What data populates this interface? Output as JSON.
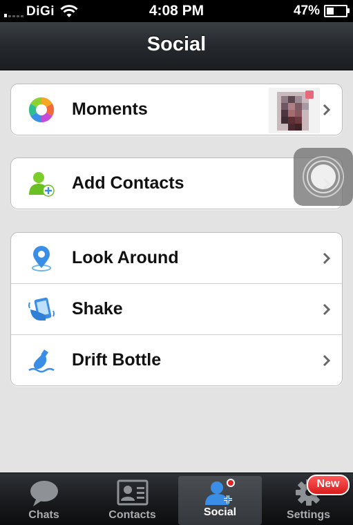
{
  "status_bar": {
    "carrier": "DiGi",
    "time": "4:08 PM",
    "battery_percent": "47%",
    "battery_level": 0.47,
    "signal_bars_active": 1
  },
  "navbar": {
    "title": "Social"
  },
  "groups": [
    {
      "rows": [
        {
          "label": "Moments",
          "icon": "moments-aperture-icon",
          "has_thumbnail": true
        }
      ]
    },
    {
      "rows": [
        {
          "label": "Add Contacts",
          "icon": "add-contact-icon"
        }
      ]
    },
    {
      "rows": [
        {
          "label": "Look Around",
          "icon": "location-pin-icon"
        },
        {
          "label": "Shake",
          "icon": "shake-phone-icon"
        },
        {
          "label": "Drift Bottle",
          "icon": "drift-bottle-icon"
        }
      ]
    }
  ],
  "tabbar": {
    "tabs": [
      {
        "label": "Chats",
        "icon": "chat-bubble-icon"
      },
      {
        "label": "Contacts",
        "icon": "contact-card-icon"
      },
      {
        "label": "Social",
        "icon": "social-add-user-icon",
        "active": true
      },
      {
        "label": "Settings",
        "icon": "gear-icon"
      }
    ],
    "settings_badge": "New"
  },
  "colors": {
    "background": "#e3e3e3",
    "navbar": "#25292d",
    "tabbar": "#1a1c1f",
    "badge_red": "#e02424",
    "accent_blue": "#3a8ee6"
  }
}
